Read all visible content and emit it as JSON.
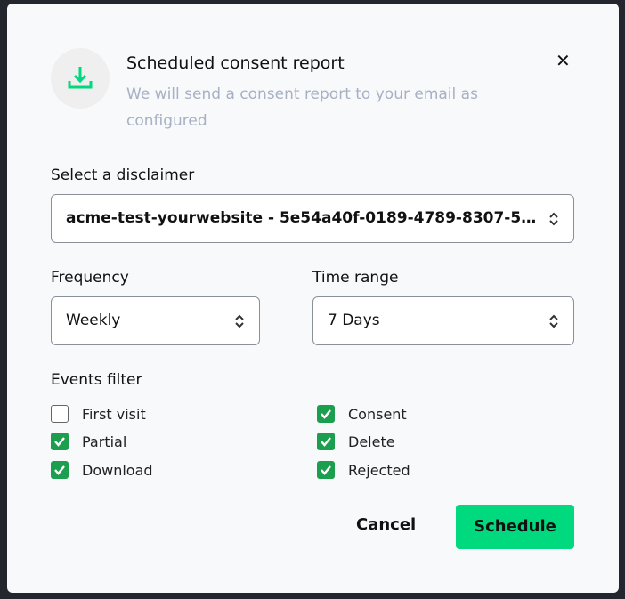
{
  "dialog": {
    "title": "Scheduled consent report",
    "subtitle": "We will send a consent report to your email as configured",
    "icon": "download-icon",
    "accent": "#00d97e"
  },
  "disclaimer": {
    "label": "Select a disclaimer",
    "value": "acme-test-yourwebsite - 5e54a40f-0189-4789-8307-5..."
  },
  "frequency": {
    "label": "Frequency",
    "value": "Weekly"
  },
  "time_range": {
    "label": "Time range",
    "value": "7 Days"
  },
  "events": {
    "label": "Events filter",
    "items": [
      {
        "label": "First visit",
        "checked": false
      },
      {
        "label": "Consent",
        "checked": true
      },
      {
        "label": "Partial",
        "checked": true
      },
      {
        "label": "Delete",
        "checked": true
      },
      {
        "label": "Download",
        "checked": true
      },
      {
        "label": "Rejected",
        "checked": true
      }
    ]
  },
  "actions": {
    "cancel": "Cancel",
    "schedule": "Schedule"
  }
}
